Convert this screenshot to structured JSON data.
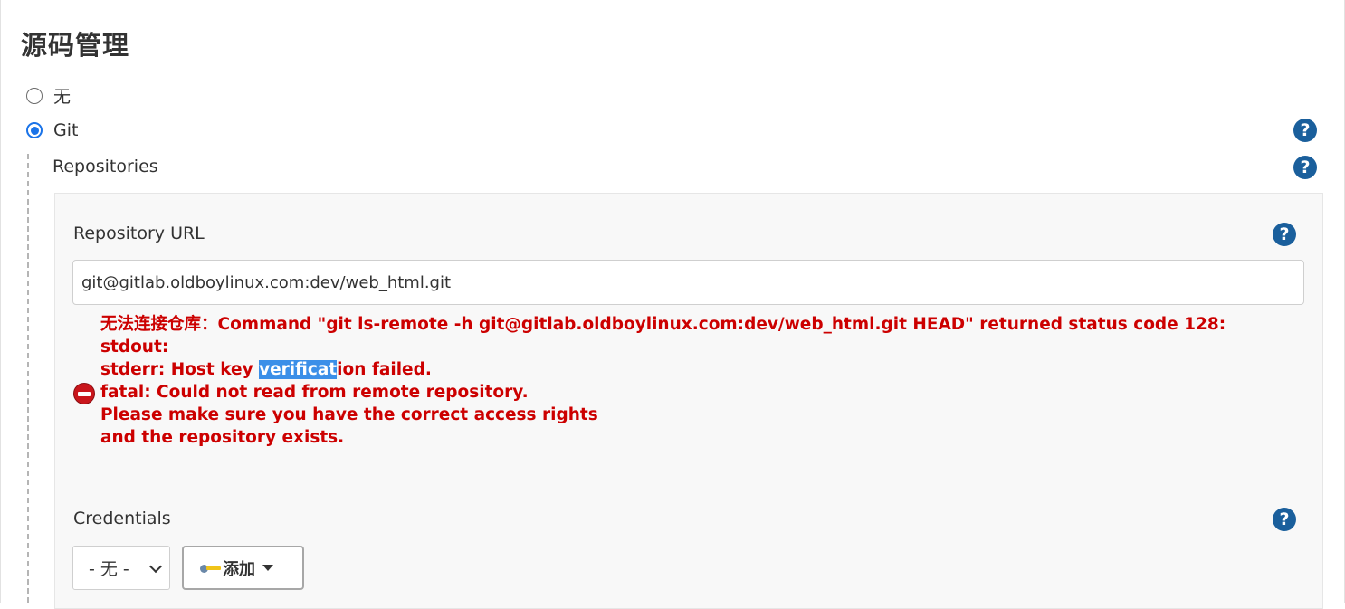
{
  "section": {
    "title": "源码管理"
  },
  "scm_options": [
    {
      "label": "无",
      "checked": false
    },
    {
      "label": "Git",
      "checked": true
    }
  ],
  "repositories": {
    "label": "Repositories"
  },
  "repository_url": {
    "label": "Repository URL",
    "value": "git@gitlab.oldboylinux.com:dev/web_html.git"
  },
  "error": {
    "line1": "无法连接仓库：Command \"git ls-remote -h git@gitlab.oldboylinux.com:dev/web_html.git HEAD\" returned status code 128:",
    "line2": "stdout:",
    "line3_before": "stderr: Host key ",
    "line3_selected": "verificat",
    "line3_after": "ion failed.",
    "line4": "fatal: Could not read from remote repository.",
    "line5": "",
    "line6": "Please make sure you have the correct access rights",
    "line7": "and the repository exists."
  },
  "credentials": {
    "label": "Credentials",
    "selected": "- 无 -",
    "add_label": "添加"
  },
  "icons": {
    "help": "question-circle-icon",
    "error": "error-stop-icon",
    "key": "key-icon"
  },
  "colors": {
    "error": "#cc0000",
    "help": "#1a5f9c",
    "radio_accent": "#1a73e8"
  }
}
